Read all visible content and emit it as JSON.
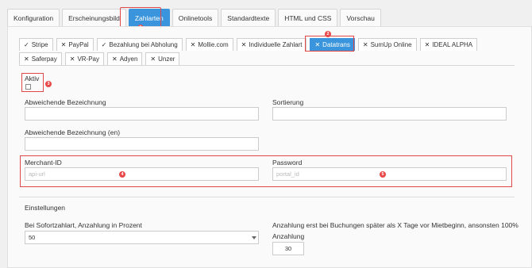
{
  "top_tabs": [
    {
      "label": "Konfiguration"
    },
    {
      "label": "Erscheinungsbild"
    },
    {
      "label": "Zahlarten"
    },
    {
      "label": "Onlinetools"
    },
    {
      "label": "Standardtexte"
    },
    {
      "label": "HTML und CSS"
    },
    {
      "label": "Vorschau"
    }
  ],
  "pay_tabs_row1": [
    {
      "mark": "✓",
      "label": "Stripe"
    },
    {
      "mark": "✕",
      "label": "PayPal"
    },
    {
      "mark": "✓",
      "label": "Bezahlung bei Abholung"
    },
    {
      "mark": "✕",
      "label": "Mollie.com"
    },
    {
      "mark": "✕",
      "label": "Individuelle Zahlart"
    },
    {
      "mark": "✕",
      "label": "Datatrans"
    },
    {
      "mark": "✕",
      "label": "SumUp Online"
    },
    {
      "mark": "✕",
      "label": "IDEAL ALPHA"
    }
  ],
  "pay_tabs_row2": [
    {
      "mark": "✕",
      "label": "Saferpay"
    },
    {
      "mark": "✕",
      "label": "VR-Pay"
    },
    {
      "mark": "✕",
      "label": "Adyen"
    },
    {
      "mark": "✕",
      "label": "Unzer"
    }
  ],
  "badges": {
    "b1": "1",
    "b2": "2",
    "b3": "3",
    "b4": "4",
    "b5": "5"
  },
  "form": {
    "aktiv_label": "Aktiv",
    "abw_bez_label": "Abweichende Bezeichnung",
    "sortierung_label": "Sortierung",
    "abw_bez_en_label": "Abweichende Bezeichnung (en)",
    "merchant_label": "Merchant-ID",
    "merchant_placeholder": "api-url",
    "password_label": "Password",
    "password_placeholder": "portal_id",
    "einstellungen_label": "Einstellungen",
    "sofort_label": "Bei Sofortzahlart, Anzahlung in Prozent",
    "sofort_value": "50",
    "anzahlung_tage_label": "Anzahlung erst bei Buchungen später als X Tage vor Mietbeginn, ansonsten 100%",
    "anzahlung_label": "Anzahlung",
    "anzahlung_value": "30"
  },
  "colors": {
    "accent": "#3a95dc",
    "highlight": "#e04848",
    "badge": "#e84848"
  }
}
